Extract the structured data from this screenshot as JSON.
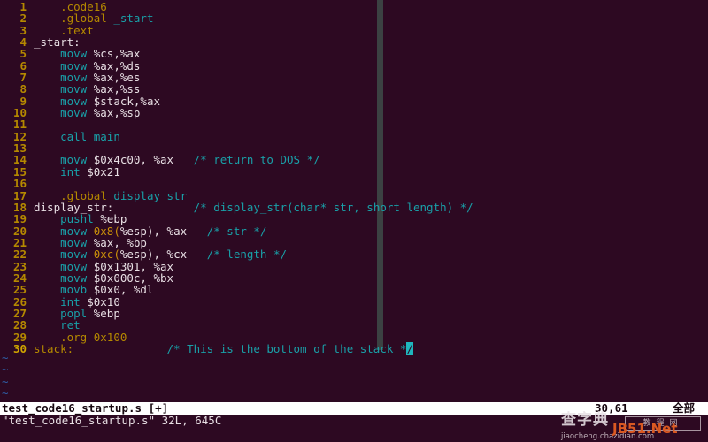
{
  "editor": {
    "app": "vim",
    "background": "#2d0922",
    "accent_cursor": "#1fb6bd",
    "annotation_color": "#d83030",
    "lines": [
      {
        "n": "1",
        "segments": [
          {
            "t": "ws",
            "v": "    "
          },
          {
            "t": "dir",
            "v": ".code16"
          }
        ]
      },
      {
        "n": "2",
        "segments": [
          {
            "t": "ws",
            "v": "    "
          },
          {
            "t": "dir",
            "v": ".global "
          },
          {
            "t": "sym",
            "v": "_start"
          }
        ]
      },
      {
        "n": "3",
        "segments": [
          {
            "t": "ws",
            "v": "    "
          },
          {
            "t": "dir",
            "v": ".text"
          }
        ]
      },
      {
        "n": "4",
        "segments": [
          {
            "t": "label",
            "v": "_start:"
          }
        ]
      },
      {
        "n": "5",
        "segments": [
          {
            "t": "ws",
            "v": "    "
          },
          {
            "t": "kw",
            "v": "movw "
          },
          {
            "t": "plain",
            "v": "%cs,%ax"
          }
        ]
      },
      {
        "n": "6",
        "segments": [
          {
            "t": "ws",
            "v": "    "
          },
          {
            "t": "kw",
            "v": "movw "
          },
          {
            "t": "plain",
            "v": "%ax,%ds"
          }
        ]
      },
      {
        "n": "7",
        "segments": [
          {
            "t": "ws",
            "v": "    "
          },
          {
            "t": "kw",
            "v": "movw "
          },
          {
            "t": "plain",
            "v": "%ax,%es"
          }
        ]
      },
      {
        "n": "8",
        "segments": [
          {
            "t": "ws",
            "v": "    "
          },
          {
            "t": "kw",
            "v": "movw "
          },
          {
            "t": "plain",
            "v": "%ax,%ss"
          }
        ]
      },
      {
        "n": "9",
        "segments": [
          {
            "t": "ws",
            "v": "    "
          },
          {
            "t": "kw",
            "v": "movw "
          },
          {
            "t": "plain",
            "v": "$stack,%ax"
          }
        ]
      },
      {
        "n": "10",
        "segments": [
          {
            "t": "ws",
            "v": "    "
          },
          {
            "t": "kw",
            "v": "movw "
          },
          {
            "t": "plain",
            "v": "%ax,%sp"
          }
        ]
      },
      {
        "n": "11",
        "segments": []
      },
      {
        "n": "12",
        "segments": [
          {
            "t": "ws",
            "v": "    "
          },
          {
            "t": "kw",
            "v": "call main"
          }
        ]
      },
      {
        "n": "13",
        "segments": []
      },
      {
        "n": "14",
        "segments": [
          {
            "t": "ws",
            "v": "    "
          },
          {
            "t": "kw",
            "v": "movw "
          },
          {
            "t": "plain",
            "v": "$0x4c00, %ax"
          },
          {
            "t": "ws",
            "v": "   "
          },
          {
            "t": "cmt",
            "v": "/* return to DOS */"
          }
        ]
      },
      {
        "n": "15",
        "segments": [
          {
            "t": "ws",
            "v": "    "
          },
          {
            "t": "kw",
            "v": "int "
          },
          {
            "t": "plain",
            "v": "$0x21"
          }
        ]
      },
      {
        "n": "16",
        "segments": []
      },
      {
        "n": "17",
        "segments": [
          {
            "t": "ws",
            "v": "    "
          },
          {
            "t": "dir",
            "v": ".global ",
            "box": "start"
          },
          {
            "t": "sym",
            "v": "display_str",
            "box": "end"
          }
        ]
      },
      {
        "n": "18",
        "segments": [
          {
            "t": "label",
            "v": "display_str:"
          },
          {
            "t": "ws",
            "v": "            "
          },
          {
            "t": "cmt",
            "v": "/* display_str(char* str, short length) */"
          }
        ]
      },
      {
        "n": "19",
        "segments": [
          {
            "t": "ws",
            "v": "    "
          },
          {
            "t": "kw",
            "v": "pushl ",
            "box": "start"
          },
          {
            "t": "plain",
            "v": "%ebp",
            "box": "end"
          }
        ]
      },
      {
        "n": "20",
        "segments": [
          {
            "t": "ws",
            "v": "    "
          },
          {
            "t": "kw",
            "v": "movw "
          },
          {
            "t": "num",
            "v": "0x8(",
            "box": "start"
          },
          {
            "t": "plain",
            "v": "%esp)",
            "box": "end"
          },
          {
            "t": "plain",
            "v": ", %ax"
          },
          {
            "t": "ws",
            "v": "   "
          },
          {
            "t": "cmt",
            "v": "/* str */"
          }
        ]
      },
      {
        "n": "21",
        "segments": [
          {
            "t": "ws",
            "v": "    "
          },
          {
            "t": "kw",
            "v": "movw "
          },
          {
            "t": "plain",
            "v": "%ax, %bp"
          }
        ]
      },
      {
        "n": "22",
        "segments": [
          {
            "t": "ws",
            "v": "    "
          },
          {
            "t": "kw",
            "v": "movw "
          },
          {
            "t": "num",
            "v": "0xc(",
            "box": "start"
          },
          {
            "t": "plain",
            "v": "%esp)",
            "box": "end"
          },
          {
            "t": "plain",
            "v": ", %cx"
          },
          {
            "t": "ws",
            "v": "   "
          },
          {
            "t": "cmt",
            "v": "/* length */"
          }
        ]
      },
      {
        "n": "23",
        "segments": [
          {
            "t": "ws",
            "v": "    "
          },
          {
            "t": "kw",
            "v": "movw "
          },
          {
            "t": "plain",
            "v": "$0x1301, %ax"
          }
        ]
      },
      {
        "n": "24",
        "segments": [
          {
            "t": "ws",
            "v": "    "
          },
          {
            "t": "kw",
            "v": "movw "
          },
          {
            "t": "plain",
            "v": "$0x000c, %bx"
          }
        ]
      },
      {
        "n": "25",
        "segments": [
          {
            "t": "ws",
            "v": "    "
          },
          {
            "t": "kw",
            "v": "movb "
          },
          {
            "t": "plain",
            "v": "$0x0, %dl"
          }
        ]
      },
      {
        "n": "26",
        "segments": [
          {
            "t": "ws",
            "v": "    "
          },
          {
            "t": "kw",
            "v": "int "
          },
          {
            "t": "plain",
            "v": "$0x10"
          }
        ]
      },
      {
        "n": "27",
        "segments": [
          {
            "t": "ws",
            "v": "    "
          },
          {
            "t": "kw",
            "v": "popl "
          },
          {
            "t": "plain",
            "v": "%ebp"
          }
        ]
      },
      {
        "n": "28",
        "segments": [
          {
            "t": "ws",
            "v": "    "
          },
          {
            "t": "kw",
            "v": "ret"
          }
        ]
      },
      {
        "n": "29",
        "segments": [
          {
            "t": "ws",
            "v": "    "
          },
          {
            "t": "dir",
            "v": ".org 0x100"
          }
        ]
      }
    ],
    "cursor_line": {
      "n": "30",
      "label": "stack:",
      "padding": "              ",
      "comment": "/* This is the bottom of the stack *",
      "cursor_char": "/"
    },
    "empty_rows": [
      "~",
      "~",
      "~",
      "~"
    ]
  },
  "statusline": {
    "filename": "test_code16_startup.s [+]",
    "position": "30,61",
    "scroll": "全部"
  },
  "cmdline": {
    "message": "\"test_code16_startup.s\" 32L, 645C"
  },
  "watermark": {
    "cn_title": "查字典",
    "cn_box": "教程网",
    "url": "jiaocheng.chazidian.com",
    "brand": "JB51.Net"
  }
}
